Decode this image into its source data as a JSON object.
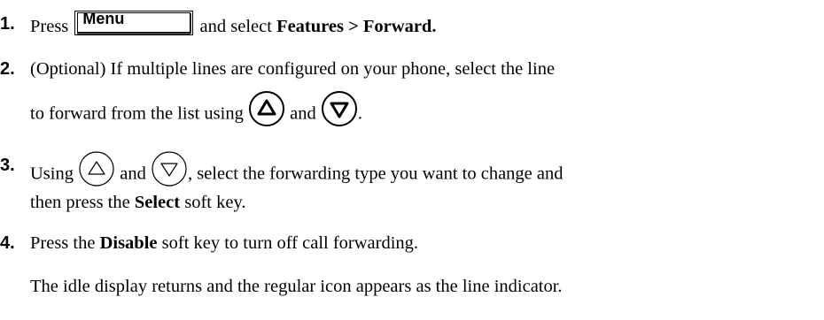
{
  "steps": [
    {
      "number": "1.",
      "before": "Press",
      "key_label": "Menu",
      "middle": " and select ",
      "bold": "Features > Forward."
    },
    {
      "number": "2.",
      "line1": "(Optional) If multiple lines are configured on your phone, select the line",
      "line2_before": "to forward from the list using",
      "and": "and",
      "end": "."
    },
    {
      "number": "3.",
      "before": "Using",
      "and": "and",
      "after": ", select the forwarding type you want to change and",
      "line2_before": "then press the ",
      "bold": "Select",
      "line2_after": " soft key."
    },
    {
      "number": "4.",
      "before": "Press the ",
      "bold": "Disable",
      "after": " soft key to turn off call forwarding.",
      "note": "The idle display returns and the regular icon appears as the line indicator."
    }
  ],
  "icons": {
    "menu_key": "menu-hard-key-icon",
    "up": "up-arrow-icon",
    "down": "down-arrow-icon"
  }
}
